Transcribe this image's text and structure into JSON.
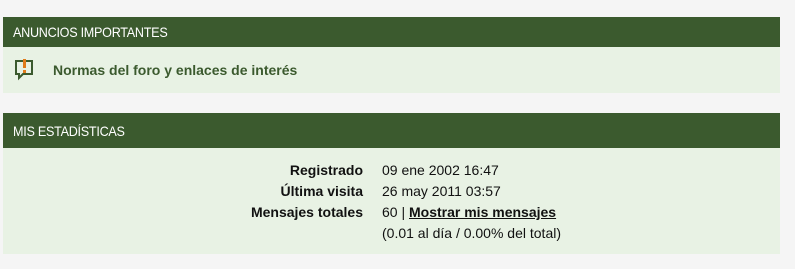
{
  "announcements": {
    "title": "ANUNCIOS IMPORTANTES",
    "items": [
      {
        "icon": "announcement-icon",
        "label": "Normas del foro y enlaces de interés"
      }
    ]
  },
  "stats": {
    "title": "MIS ESTADÍSTICAS",
    "registered": {
      "label": "Registrado",
      "value": "09 ene 2002 16:47"
    },
    "last_visit": {
      "label": "Última visita",
      "value": "26 may 2011 03:57"
    },
    "total_posts": {
      "label": "Mensajes totales",
      "count": "60",
      "separator": "|",
      "link_label": "Mostrar mis mensajes",
      "detail": "(0.01 al día / 0.00% del total)"
    }
  },
  "colors": {
    "header_bg": "#3b5a2e",
    "body_bg": "#e8f2e4",
    "icon_orange": "#e07b1a",
    "link_green": "#3b5a2e"
  }
}
